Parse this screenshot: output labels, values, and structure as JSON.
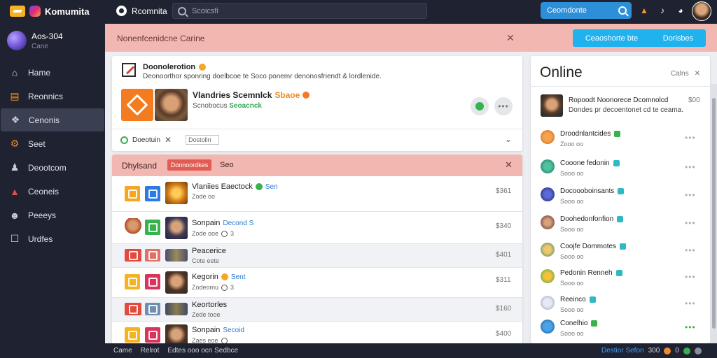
{
  "app": {
    "name": "Komumita"
  },
  "profile": {
    "name": "Aos-304",
    "sub": "Cane"
  },
  "sidebar": {
    "items": [
      {
        "label": "Hame",
        "icon": "home-icon"
      },
      {
        "label": "Reonnics",
        "icon": "briefcase-icon"
      },
      {
        "label": "Cenonis",
        "icon": "puzzle-icon",
        "active": true
      },
      {
        "label": "Seet",
        "icon": "gear-icon"
      },
      {
        "label": "Deootcom",
        "icon": "users-icon"
      },
      {
        "label": "Ceoneis",
        "icon": "chart-icon"
      },
      {
        "label": "Peeeys",
        "icon": "person-icon"
      },
      {
        "label": "Urdfes",
        "icon": "link-icon"
      }
    ]
  },
  "topbar": {
    "app_label": "Rcomnita",
    "search_placeholder": "Scoicsfi",
    "search_button": "Ceomdonte"
  },
  "banner": {
    "text": "Nonenfcenidcne Carine",
    "button_left": "Ceaoshorte bte",
    "button_right": "Dorisbes"
  },
  "feed": {
    "title": "Doonolerotion",
    "desc": "Deonoorthor sponring doelbcoe te Soco ponemr denonosfriendt & lordlenide.",
    "item_name": "Vlandries Scemnlck",
    "item_tag": "Sbaoe",
    "item_sub": "Scnobocus",
    "item_sub_green": "Seoacnck",
    "filter_label": "Doeotuin",
    "filter_input": "Dostolln"
  },
  "list": {
    "title": "Dhylsand",
    "badge": "Donnoordkes",
    "extra": "Seo",
    "rows": [
      {
        "name": "Vlaniies Eaectock",
        "tag": "Sen",
        "sub": "Zode oo",
        "value": "$361"
      },
      {
        "name": "Sonpain",
        "tag": "Decond S",
        "sub": "Zode ooe",
        "sub_extra": "3",
        "value": "$340"
      },
      {
        "name": "Peacerice",
        "tag": "",
        "sub": "Cote eete",
        "sub_extra": "",
        "value": "$401"
      },
      {
        "name": "Kegorin",
        "tag": "Sent",
        "sub": "Zodeomu",
        "sub_extra": "3",
        "value": "$311"
      },
      {
        "name": "Keortorles",
        "tag": "",
        "sub": "Zede tooe",
        "sub_extra": "",
        "value": "$160"
      },
      {
        "name": "Sonpain",
        "tag": "Secoid",
        "sub": "Zaes eoe",
        "sub_extra": "",
        "value": "$400"
      }
    ]
  },
  "online": {
    "title": "Online",
    "link": "Calns",
    "featured": {
      "name": "Ropoodt Noonorece Dcomnolcd",
      "value": "$00",
      "desc": "Dondes pr decoentonet cd te ceama."
    },
    "friends": [
      {
        "name": "Droodnlantcides",
        "sub": "Zooo oo"
      },
      {
        "name": "Cooone fedonin",
        "sub": "Sooo oo"
      },
      {
        "name": "Docoooboinsants",
        "sub": "Sooo oo"
      },
      {
        "name": "Doohedonfonfion",
        "sub": "Sooo oo"
      },
      {
        "name": "Coojfe Dommotes",
        "sub": "Sooo oo"
      },
      {
        "name": "Pedonin Renneh",
        "sub": "Sooo oo"
      },
      {
        "name": "Reeinco",
        "sub": "Sooo oo"
      },
      {
        "name": "Conelhio",
        "sub": "Sooo oo"
      }
    ]
  },
  "statusbar": {
    "left_1": "Came",
    "left_2": "Relrot",
    "left_3": "Edtes ooo ocn Sedbce",
    "link": "Destior Sefon",
    "count": "300",
    "right_extra": "0"
  },
  "colors": {
    "sidebar": "#1f2230",
    "banner": "#f3b7b2",
    "accent": "#20b1ef",
    "online_green": "#37b24d"
  }
}
